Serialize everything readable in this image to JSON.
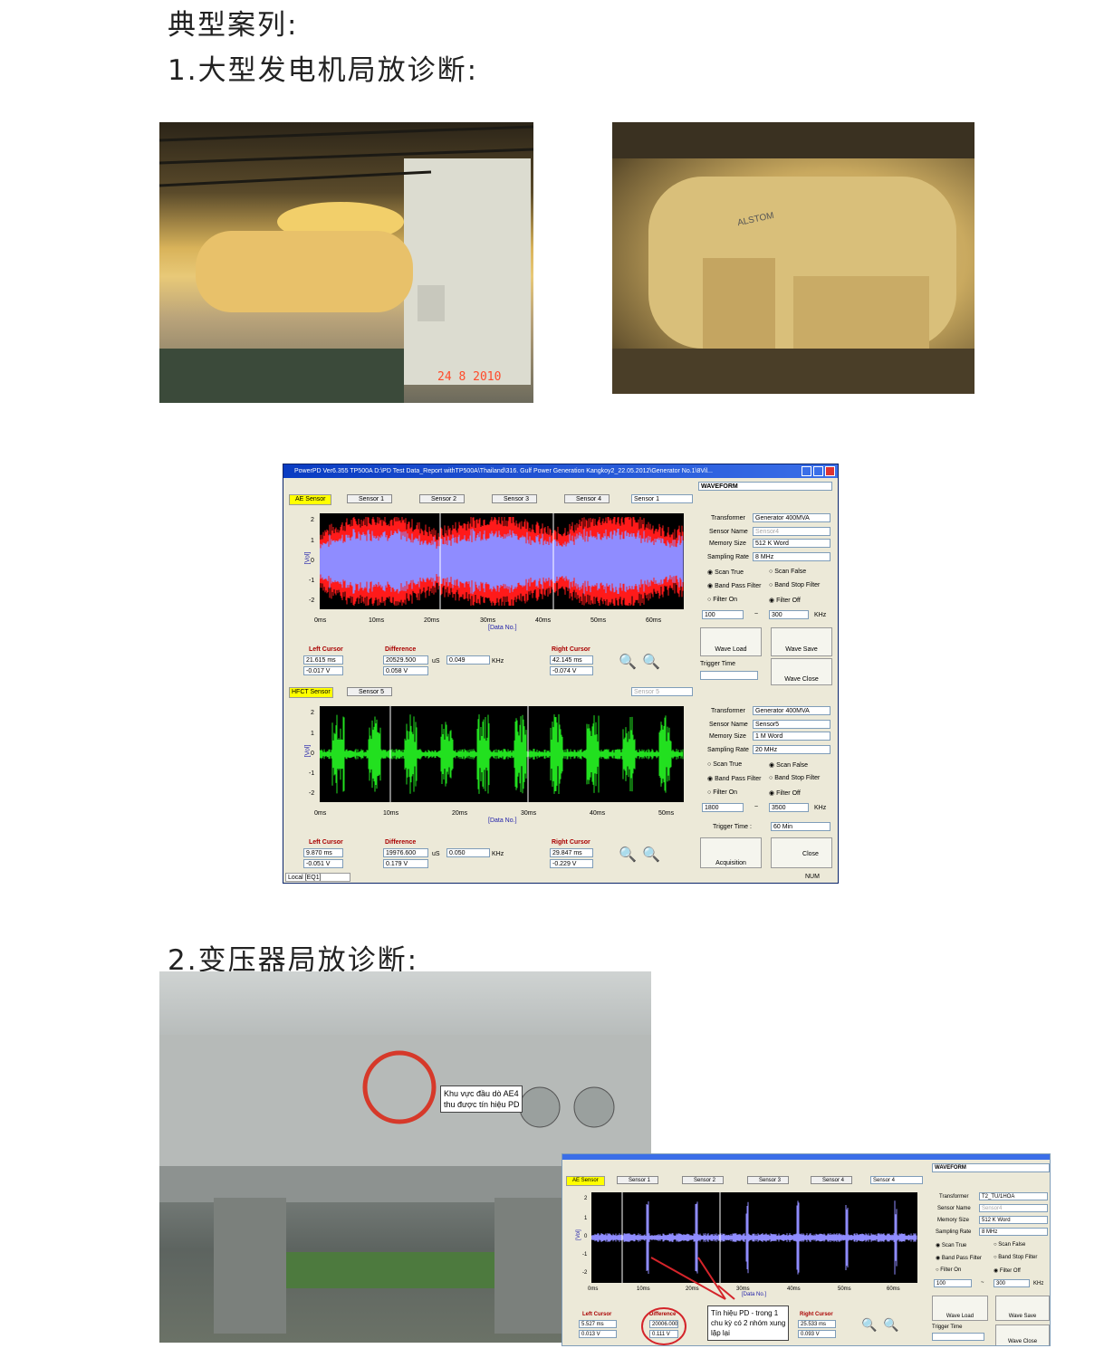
{
  "heading_cases": "典型案列:",
  "heading_generator": "1.大型发电机局放诊断:",
  "heading_transformer": "2.变压器局放诊断:",
  "photo1": {
    "date_stamp": "24  8 2010"
  },
  "photo2": {
    "badge": "ALSTOM"
  },
  "app": {
    "title": "PowerPD Ver6.355 TP500A D:\\PD Test Data_Report withTP500A\\Thailand\\316. Gulf Power Generation Kangkoy2_22.05.2012\\Generator No.1\\8Vil...",
    "mode": "WAVEFORM",
    "ae": {
      "label": "AE Sensor",
      "sensors": [
        "Sensor 1",
        "Sensor 2",
        "Sensor 3",
        "Sensor 4"
      ],
      "select": "Sensor 1",
      "xticks": [
        "0ms",
        "10ms",
        "20ms",
        "30ms",
        "40ms",
        "50ms",
        "60ms"
      ],
      "yticks": [
        "2",
        "1",
        "0",
        "-1",
        "-2"
      ],
      "xlabel": "[Data No.]",
      "ylabel": "[Vol]",
      "left_cursor": {
        "label": "Left Cursor",
        "time": "21.615 ms",
        "volt": "-0.017 V"
      },
      "difference": {
        "label": "Difference",
        "time": "20529.500",
        "unit": "uS",
        "freq": "0.049",
        "funit": "KHz",
        "volt": "0.058 V"
      },
      "right_cursor": {
        "label": "Right Cursor",
        "time": "42.145 ms",
        "volt": "-0.074 V"
      },
      "settings": {
        "transformer": [
          "Transformer",
          "Generator 400MVA"
        ],
        "sensor_name": [
          "Sensor Name",
          "Sensor4"
        ],
        "memory": [
          "Memory Size",
          "512 K Word"
        ],
        "rate": [
          "Sampling Rate",
          "8 MHz"
        ],
        "scan_true": "Scan True",
        "scan_false": "Scan False",
        "bpf": "Band Pass Filter",
        "bsf": "Band Stop Filter",
        "filter_on": "Filter On",
        "filter_off": "Filter Off",
        "low": "100",
        "tilde": "~",
        "high": "300",
        "khz": "KHz"
      },
      "wave_load": "Wave Load",
      "wave_save": "Wave Save",
      "trigger_time": "Trigger Time",
      "wave_close": "Wave Close"
    },
    "hfct": {
      "label": "HFCT Sensor",
      "sensor": "Sensor 5",
      "select": "Sensor 5",
      "xticks": [
        "0ms",
        "10ms",
        "20ms",
        "30ms",
        "40ms",
        "50ms"
      ],
      "yticks": [
        "2",
        "1",
        "0",
        "-1",
        "-2"
      ],
      "xlabel": "[Data No.]",
      "ylabel": "[Vol]",
      "left_cursor": {
        "label": "Left Cursor",
        "time": "9.870 ms",
        "volt": "-0.051 V"
      },
      "difference": {
        "label": "Difference",
        "time": "19976.600",
        "unit": "uS",
        "freq": "0.050",
        "funit": "KHz",
        "volt": "0.179 V"
      },
      "right_cursor": {
        "label": "Right Cursor",
        "time": "29.847 ms",
        "volt": "-0.229 V"
      },
      "settings": {
        "transformer": [
          "Transformer",
          "Generator 400MVA"
        ],
        "sensor_name": [
          "Sensor Name",
          "Sensor5"
        ],
        "memory": [
          "Memory Size",
          "1 M Word"
        ],
        "rate": [
          "Sampling Rate",
          "20 MHz"
        ],
        "scan_true": "Scan True",
        "scan_false": "Scan False",
        "bpf": "Band Pass Filter",
        "bsf": "Band Stop Filter",
        "filter_on": "Filter On",
        "filter_off": "Filter Off",
        "low": "1800",
        "tilde": "~",
        "high": "3500",
        "khz": "KHz"
      },
      "trigger_label": "Trigger Time :",
      "trigger_value": "60 Min",
      "acquisition": "Acquisition",
      "close": "Close"
    },
    "status": {
      "left": "Local  [EQ1]",
      "right": "NUM"
    }
  },
  "transformer_case": {
    "callout1": [
      "Khu vực đầu dò AE4",
      "thu được tín hiệu PD"
    ],
    "callout2": [
      "Tín hiệu PD - trong 1",
      "chu kỳ có 2 nhóm xung",
      "lặp lại"
    ],
    "app": {
      "mode": "WAVEFORM",
      "ae_label": "AE Sensor",
      "sensors": [
        "Sensor 1",
        "Sensor 2",
        "Sensor 3",
        "Sensor 4"
      ],
      "select": "Sensor 4",
      "xticks": [
        "0ms",
        "10ms",
        "20ms",
        "30ms",
        "40ms",
        "50ms",
        "60ms"
      ],
      "yticks": [
        "2",
        "1",
        "0",
        "-1",
        "-2"
      ],
      "xlabel": "[Data No.]",
      "ylabel": "[Vol]",
      "left_cursor": {
        "label": "Left Cursor",
        "time": "5.527 ms",
        "volt": "0.013 V"
      },
      "difference": {
        "label": "Difference",
        "time": "20006.000",
        "volt": "0.111 V"
      },
      "right_cursor": {
        "label": "Right Cursor",
        "time": "25.533 ms",
        "volt": "0.093 V"
      },
      "settings": {
        "transformer": [
          "Transformer",
          "T2_TU/1HOA"
        ],
        "sensor_name": [
          "Sensor Name",
          "Sensor4"
        ],
        "memory": [
          "Memory Size",
          "512 K Word"
        ],
        "rate": [
          "Sampling Rate",
          "8 MHz"
        ],
        "scan_true": "Scan True",
        "scan_false": "Scan False",
        "bpf": "Band Pass Filter",
        "bsf": "Band Stop Filter",
        "filter_on": "Filter On",
        "filter_off": "Filter Off",
        "low": "100",
        "tilde": "~",
        "high": "300",
        "khz": "KHz"
      },
      "wave_load": "Wave Load",
      "wave_save": "Wave Save",
      "trigger_time": "Trigger Time",
      "wave_close": "Wave Close"
    }
  }
}
